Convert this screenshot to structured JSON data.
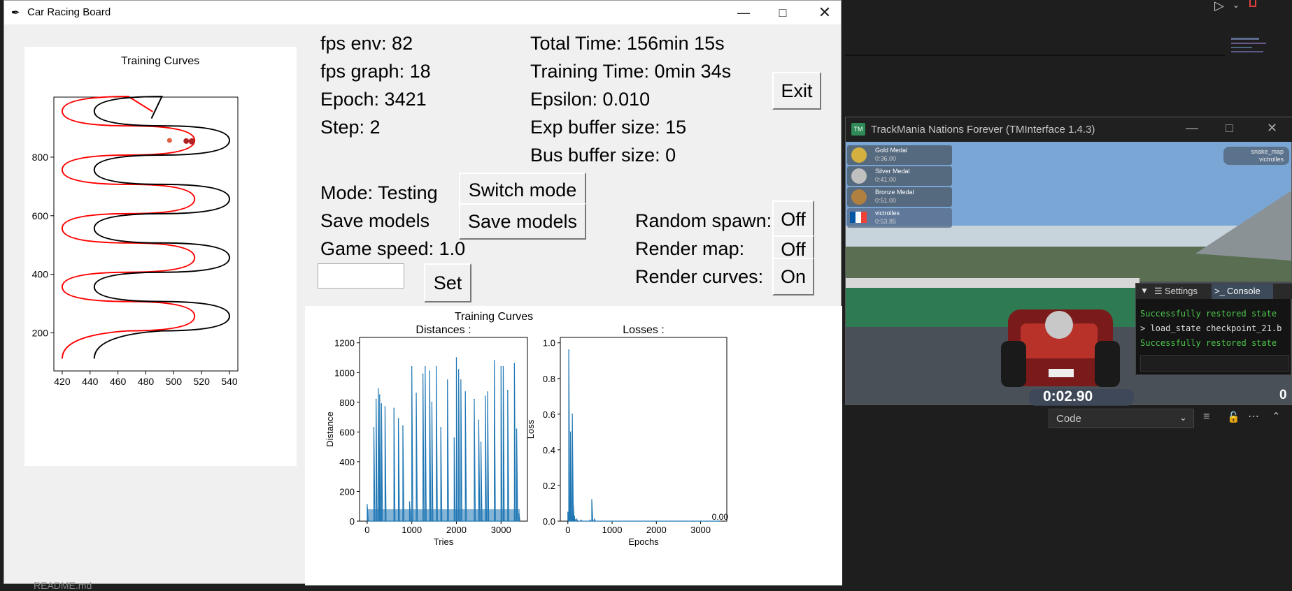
{
  "window": {
    "title": "Car Racing Board",
    "minimize_icon": "minimize-icon",
    "maximize_icon": "maximize-icon",
    "close_icon": "close-icon"
  },
  "stats": {
    "fps_env": "fps env: 82",
    "fps_graph": "fps graph: 18",
    "epoch": "Epoch: 3421",
    "step": "Step: 2",
    "total_time": "Total Time: 156min 15s",
    "training_time": "Training Time: 0min 34s",
    "epsilon": "Epsilon: 0.010",
    "exp_buffer": "Exp buffer size: 15",
    "bus_buffer": "Bus buffer size: 0"
  },
  "controls": {
    "exit_label": "Exit",
    "mode_text": "Mode: Testing",
    "switch_mode_label": "Switch mode",
    "save_models_text": "Save models",
    "save_models_label": "Save models",
    "game_speed_text": "Game speed: 1.0",
    "game_speed_value": "",
    "set_label": "Set",
    "random_spawn_text": "Random spawn:",
    "random_spawn_value": "Off",
    "render_map_text": "Render map:",
    "render_map_value": "Off",
    "render_curves_text": "Render curves:",
    "render_curves_value": "On"
  },
  "track_plot": {
    "title": "Training Curves",
    "xticks": [
      "420",
      "440",
      "460",
      "480",
      "500",
      "520",
      "540"
    ],
    "yticks": [
      "200",
      "400",
      "600",
      "800"
    ],
    "colors": {
      "left_edge": "#ff0000",
      "right_edge": "#000000",
      "car": "#b22222",
      "point": "#e06040"
    }
  },
  "curves": {
    "title": "Training Curves",
    "distances": {
      "title": "Distances :",
      "xlabel": "Tries",
      "ylabel": "Distance",
      "xticks": [
        "0",
        "1000",
        "2000",
        "3000"
      ],
      "yticks": [
        "0",
        "200",
        "400",
        "600",
        "800",
        "1000",
        "1200"
      ]
    },
    "losses": {
      "title": "Losses :",
      "xlabel": "Epochs",
      "ylabel": "Loss",
      "xticks": [
        "0",
        "1000",
        "2000",
        "3000"
      ],
      "yticks": [
        "0.0",
        "0.2",
        "0.4",
        "0.6",
        "0.8",
        "1.0"
      ],
      "last_value": "0.00"
    },
    "color": "#1f77b4"
  },
  "chart_data": [
    {
      "type": "line",
      "title": "Distances :",
      "xlabel": "Tries",
      "ylabel": "Distance",
      "xlim": [
        0,
        3421
      ],
      "ylim": [
        0,
        1200
      ],
      "series": [
        {
          "x": [
            0,
            150,
            200,
            250,
            280,
            320,
            400,
            600,
            700,
            800,
            950,
            1000,
            1100,
            1250,
            1300,
            1400,
            1450,
            1550,
            1650,
            1800,
            1950,
            2000,
            2050,
            2100,
            2200,
            2400,
            2500,
            2550,
            2650,
            2700,
            2850,
            3000,
            3050,
            3150,
            3300,
            3350,
            3400
          ],
          "y": [
            110,
            630,
            820,
            890,
            850,
            790,
            770,
            760,
            690,
            640,
            130,
            1040,
            860,
            990,
            1040,
            1010,
            800,
            1040,
            630,
            950,
            560,
            1100,
            1020,
            950,
            870,
            820,
            680,
            530,
            840,
            870,
            1080,
            1040,
            1040,
            880,
            1060,
            620,
            50
          ]
        }
      ]
    },
    {
      "type": "line",
      "title": "Losses :",
      "xlabel": "Epochs",
      "ylabel": "Loss",
      "xlim": [
        0,
        3421
      ],
      "ylim": [
        0,
        1.0
      ],
      "series": [
        {
          "x": [
            0,
            20,
            40,
            60,
            80,
            100,
            120,
            140,
            160,
            200,
            300,
            500,
            540,
            560,
            600,
            1000,
            2000,
            3000,
            3421
          ],
          "y": [
            0.05,
            0.96,
            0.15,
            0.5,
            0.05,
            0.6,
            0.1,
            0.02,
            0.01,
            0.01,
            0.005,
            0.005,
            0.12,
            0.005,
            0.01,
            0.0,
            0.0,
            0.0,
            0.0
          ]
        }
      ]
    }
  ],
  "tm": {
    "title": "TrackMania Nations Forever (TMInterface 1.4.3)",
    "medals": [
      "Gold Medal",
      "Silver Medal",
      "Bronze Medal",
      "victrolles"
    ],
    "medal_times": [
      "0:36.00",
      "0:41.00",
      "0:51.00",
      "0:53.85"
    ],
    "map_name": "snake_map",
    "author": "victrolles",
    "timer": "0:02.90",
    "speed": "0",
    "tab_settings": "Settings",
    "tab_console": "Console",
    "console_lines": [
      "Successfully restored state",
      "load_state checkpoint_21.b",
      "Successfully restored state"
    ]
  },
  "editor": {
    "language": "Code",
    "readme": "README.md"
  }
}
